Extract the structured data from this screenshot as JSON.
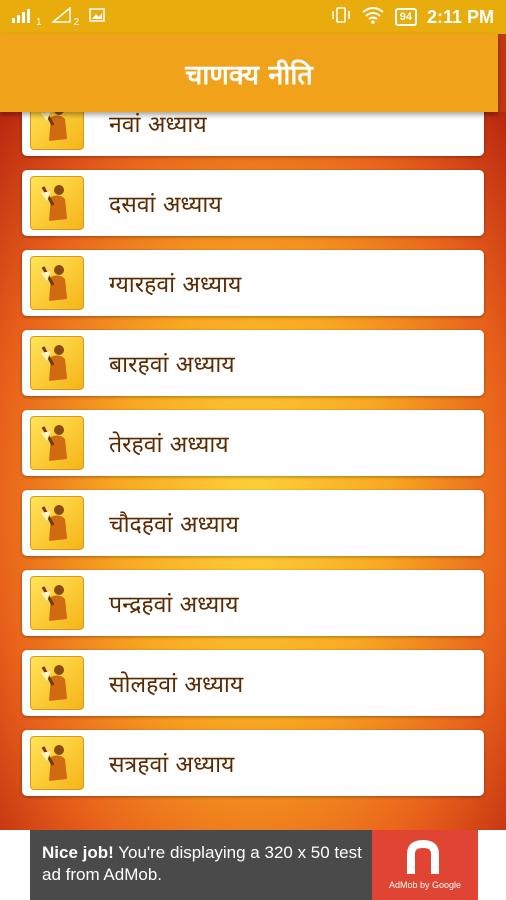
{
  "status_bar": {
    "time": "2:11 PM",
    "battery": "94",
    "sim1": "1",
    "sim2": "2"
  },
  "app_bar": {
    "title": "चाणक्य नीति"
  },
  "chapters": [
    {
      "label": "नवां अध्याय"
    },
    {
      "label": "दसवां अध्याय"
    },
    {
      "label": "ग्यारहवां अध्याय"
    },
    {
      "label": "बारहवां अध्याय"
    },
    {
      "label": "तेरहवां अध्याय"
    },
    {
      "label": "चौदहवां अध्याय"
    },
    {
      "label": "पन्द्रहवां अध्याय"
    },
    {
      "label": "सोलहवां अध्याय"
    },
    {
      "label": "सत्रहवां अध्याय"
    }
  ],
  "ad": {
    "headline": "Nice job!",
    "body": " You're displaying a 320 x 50 test ad from AdMob.",
    "logo_caption": "AdMob by Google"
  },
  "colors": {
    "status_bar": "#e8ac0d",
    "app_bar": "#f0a31a",
    "ad_logo": "#e04433"
  }
}
